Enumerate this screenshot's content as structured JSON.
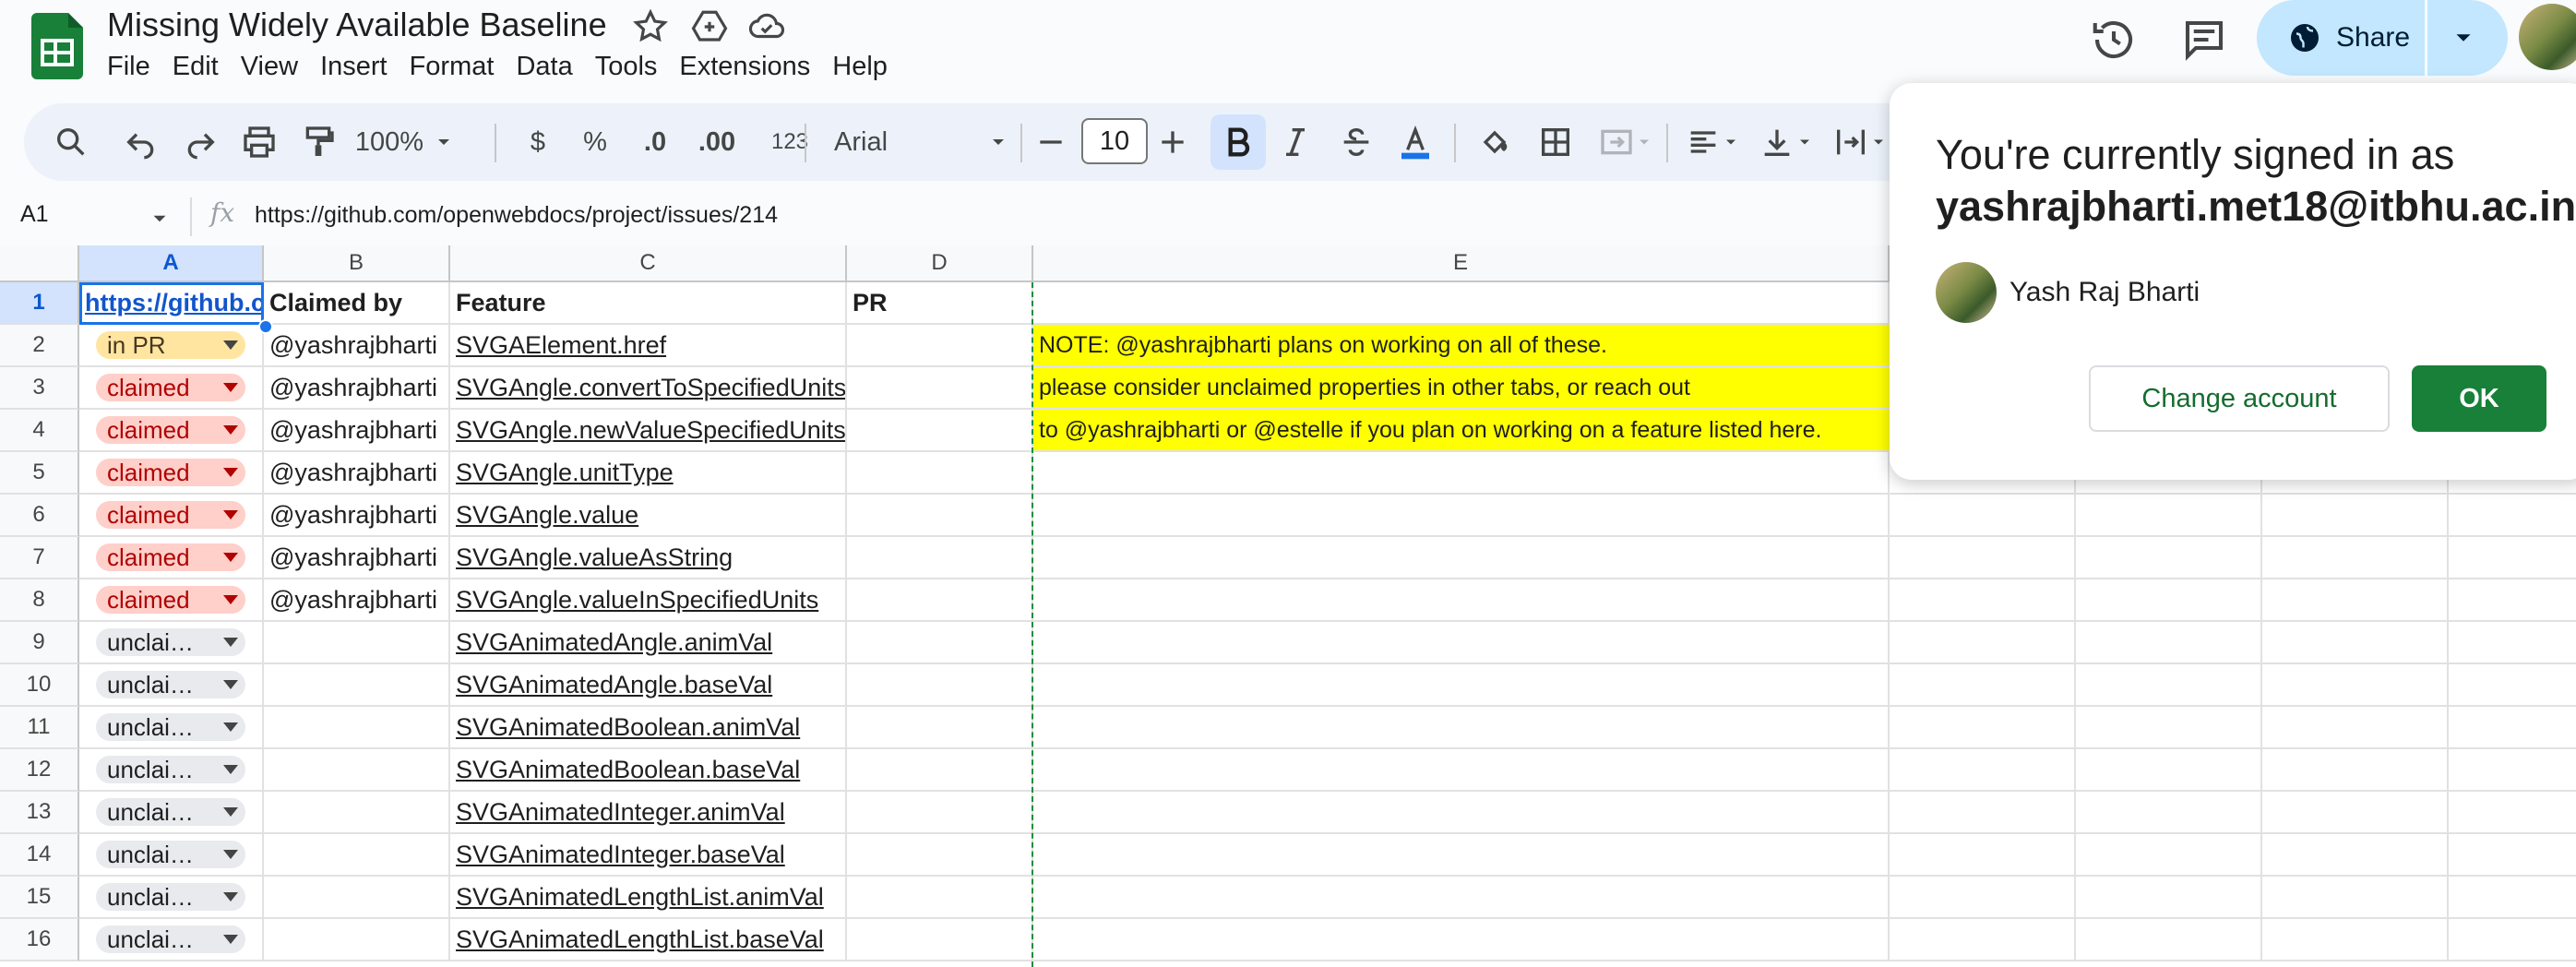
{
  "app": {
    "doc_title": "Missing Widely Available Baseline",
    "menu": [
      "File",
      "Edit",
      "View",
      "Insert",
      "Format",
      "Data",
      "Tools",
      "Extensions",
      "Help"
    ],
    "share_label": "Share",
    "brand_color": "#188038",
    "share_bg": "#c2e7ff"
  },
  "toolbar": {
    "zoom": "100%",
    "currency": "$",
    "percent": "%",
    "dec_decrease": ".0",
    "dec_increase": ".00",
    "number_format": "123",
    "font_family": "Arial",
    "font_size": "10",
    "icons": [
      "search-icon",
      "undo-icon",
      "redo-icon",
      "print-icon",
      "paint-format-icon",
      "minus-icon",
      "plus-icon",
      "bold-icon",
      "italic-icon",
      "strikethrough-icon",
      "text-color-icon",
      "fill-color-icon",
      "borders-icon",
      "merge-icon",
      "align-icon",
      "valign-icon",
      "wrap-icon"
    ]
  },
  "formula_bar": {
    "name_box": "A1",
    "fx": "fx",
    "formula": "https://github.com/openwebdocs/project/issues/214"
  },
  "grid": {
    "columns": [
      "A",
      "B",
      "C",
      "D",
      "E"
    ],
    "rows": [
      {
        "num": "1",
        "a": "https://github.com/openwebdocs/project/issues/214",
        "a_type": "link",
        "b": "Claimed by",
        "c": "Feature",
        "d": "PR"
      },
      {
        "num": "2",
        "a": "in PR",
        "a_type": "inpr",
        "b": "@yashrajbharti",
        "c": "SVGAElement.href",
        "d": ""
      },
      {
        "num": "3",
        "a": "claimed",
        "a_type": "claimed",
        "b": "@yashrajbharti",
        "c": "SVGAngle.convertToSpecifiedUnits",
        "d": ""
      },
      {
        "num": "4",
        "a": "claimed",
        "a_type": "claimed",
        "b": "@yashrajbharti",
        "c": "SVGAngle.newValueSpecifiedUnits",
        "d": ""
      },
      {
        "num": "5",
        "a": "claimed",
        "a_type": "claimed",
        "b": "@yashrajbharti",
        "c": "SVGAngle.unitType",
        "d": ""
      },
      {
        "num": "6",
        "a": "claimed",
        "a_type": "claimed",
        "b": "@yashrajbharti",
        "c": "SVGAngle.value",
        "d": ""
      },
      {
        "num": "7",
        "a": "claimed",
        "a_type": "claimed",
        "b": "@yashrajbharti",
        "c": "SVGAngle.valueAsString",
        "d": ""
      },
      {
        "num": "8",
        "a": "claimed",
        "a_type": "claimed",
        "b": "@yashrajbharti",
        "c": "SVGAngle.valueInSpecifiedUnits",
        "d": ""
      },
      {
        "num": "9",
        "a": "unclai…",
        "a_type": "uncl",
        "b": "",
        "c": "SVGAnimatedAngle.animVal",
        "d": ""
      },
      {
        "num": "10",
        "a": "unclai…",
        "a_type": "uncl",
        "b": "",
        "c": "SVGAnimatedAngle.baseVal",
        "d": ""
      },
      {
        "num": "11",
        "a": "unclai…",
        "a_type": "uncl",
        "b": "",
        "c": "SVGAnimatedBoolean.animVal",
        "d": ""
      },
      {
        "num": "12",
        "a": "unclai…",
        "a_type": "uncl",
        "b": "",
        "c": "SVGAnimatedBoolean.baseVal",
        "d": ""
      },
      {
        "num": "13",
        "a": "unclai…",
        "a_type": "uncl",
        "b": "",
        "c": "SVGAnimatedInteger.animVal",
        "d": ""
      },
      {
        "num": "14",
        "a": "unclai…",
        "a_type": "uncl",
        "b": "",
        "c": "SVGAnimatedInteger.baseVal",
        "d": ""
      },
      {
        "num": "15",
        "a": "unclai…",
        "a_type": "uncl",
        "b": "",
        "c": "SVGAnimatedLengthList.animVal",
        "d": ""
      },
      {
        "num": "16",
        "a": "unclai…",
        "a_type": "uncl",
        "b": "",
        "c": "SVGAnimatedLengthList.baseVal",
        "d": ""
      }
    ],
    "note_lines": [
      "NOTE: @yashrajbharti  plans on working on all of these.",
      "please consider unclaimed properties in other tabs, or reach out",
      "to @yashrajbharti  or @estelle if you plan on working on a feature listed here."
    ],
    "note_color": "#ffff00"
  },
  "popup": {
    "line1": "You're currently signed in as",
    "email": "yashrajbharti.met18@itbhu.ac.in",
    "name": "Yash Raj Bharti",
    "change_label": "Change account",
    "ok_label": "OK"
  }
}
